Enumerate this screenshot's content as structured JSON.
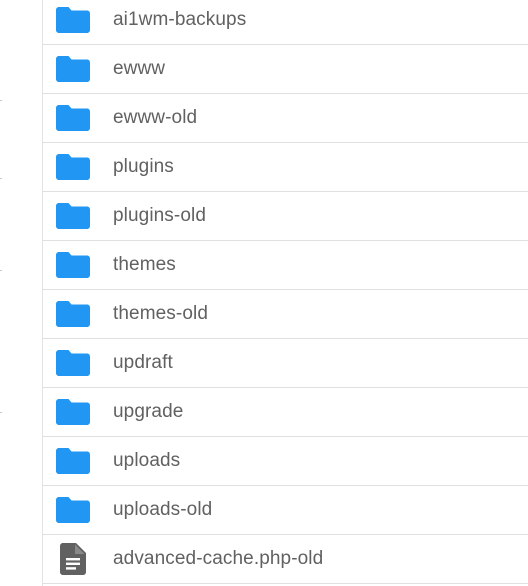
{
  "colors": {
    "folder_icon": "#2196f3",
    "file_icon": "#616161",
    "label_text": "#616161",
    "row_divider": "#e0e0e0"
  },
  "file_list": {
    "items": [
      {
        "name": "ai1wm-backups",
        "type": "folder",
        "icon": "folder-icon"
      },
      {
        "name": "ewww",
        "type": "folder",
        "icon": "folder-icon"
      },
      {
        "name": "ewww-old",
        "type": "folder",
        "icon": "folder-icon"
      },
      {
        "name": "plugins",
        "type": "folder",
        "icon": "folder-icon"
      },
      {
        "name": "plugins-old",
        "type": "folder",
        "icon": "folder-icon"
      },
      {
        "name": "themes",
        "type": "folder",
        "icon": "folder-icon"
      },
      {
        "name": "themes-old",
        "type": "folder",
        "icon": "folder-icon"
      },
      {
        "name": "updraft",
        "type": "folder",
        "icon": "folder-icon"
      },
      {
        "name": "upgrade",
        "type": "folder",
        "icon": "folder-icon"
      },
      {
        "name": "uploads",
        "type": "folder",
        "icon": "folder-icon"
      },
      {
        "name": "uploads-old",
        "type": "folder",
        "icon": "folder-icon"
      },
      {
        "name": "advanced-cache.php-old",
        "type": "file",
        "icon": "file-document-icon"
      }
    ]
  }
}
